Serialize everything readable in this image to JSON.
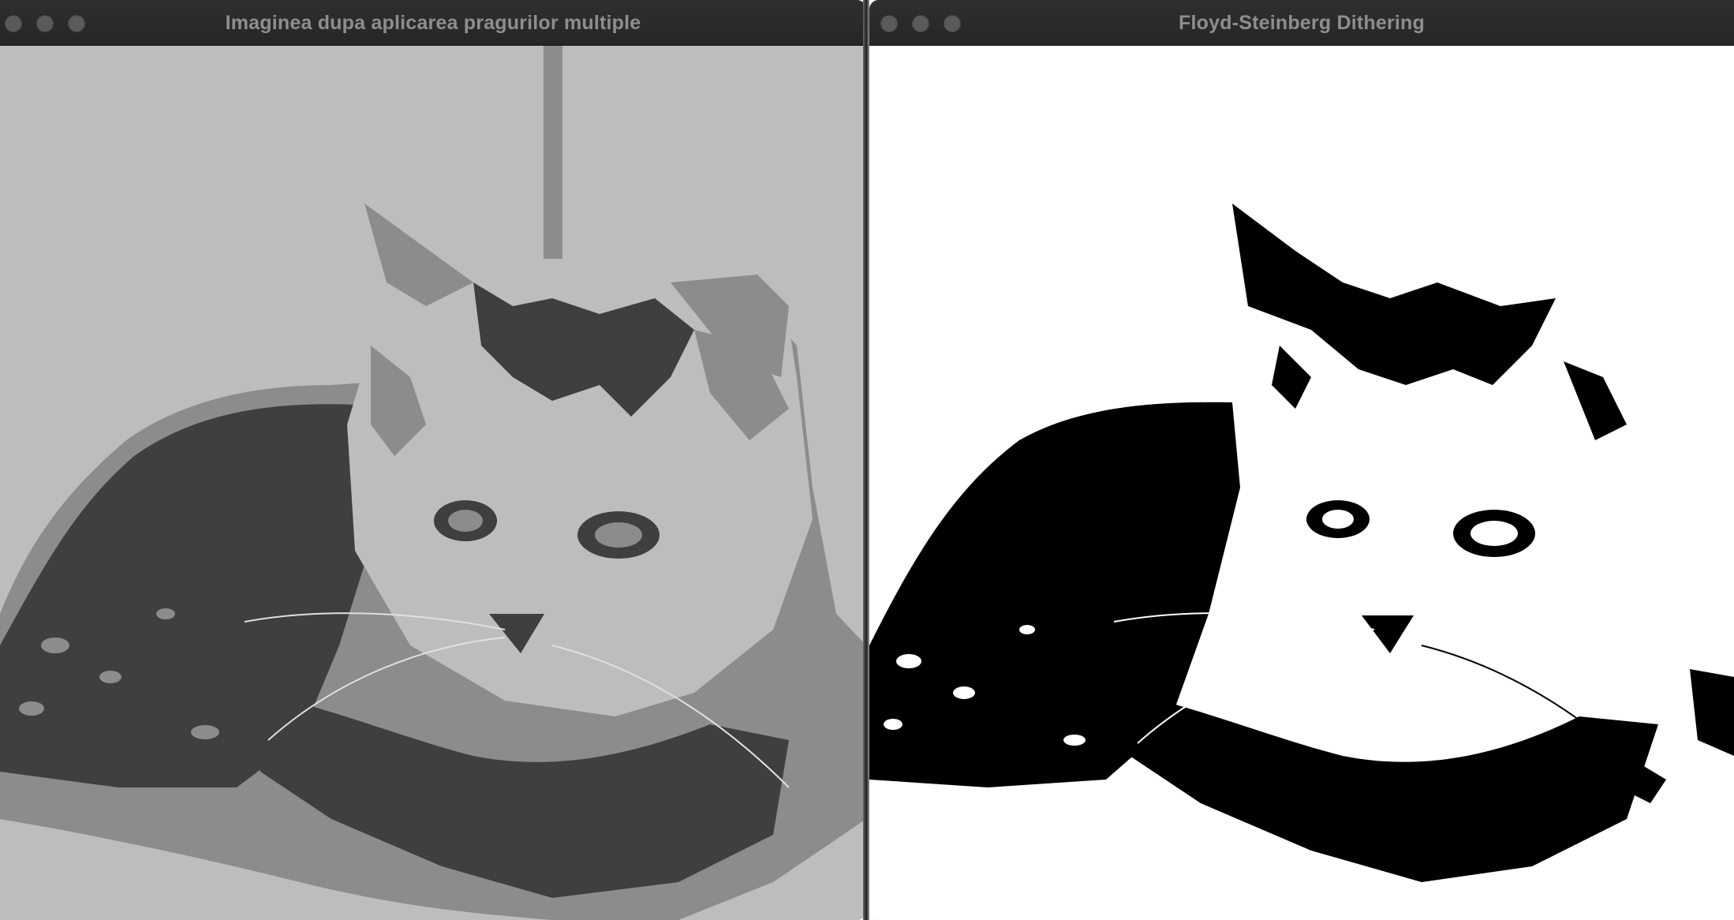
{
  "windows": [
    {
      "title": "Imaginea dupa aplicarea pragurilor multiple",
      "content": "cat-photo-multi-threshold",
      "palette": [
        "#bdbdbd",
        "#8c8c8c",
        "#3f3f3f"
      ]
    },
    {
      "title": "Floyd-Steinberg Dithering",
      "content": "cat-photo-dithered",
      "palette": [
        "#ffffff",
        "#000000"
      ]
    }
  ],
  "icons": {
    "close": "close-button-icon",
    "minimize": "minimize-button-icon",
    "zoom": "zoom-button-icon"
  }
}
